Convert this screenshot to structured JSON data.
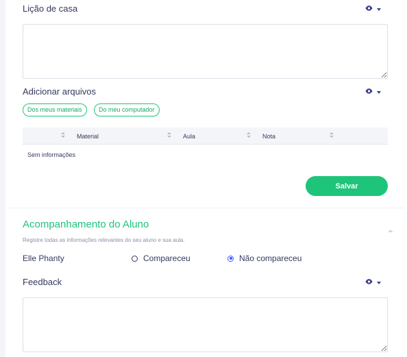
{
  "homework": {
    "label": "Lição de casa"
  },
  "files": {
    "label": "Adicionar arquivos",
    "chips": [
      "Dos meus materiais",
      "Do meu computador"
    ],
    "columns": [
      "Material",
      "Aula",
      "Nota"
    ],
    "empty_text": "Sem informações"
  },
  "save_label": "Salvar",
  "followup": {
    "title": "Acompanhamento do Aluno",
    "subtitle": "Registre todas as informações relevantes do seu aluno e sua aula.",
    "student_name": "Elle Phanty",
    "attendance_options": [
      "Compareceu",
      "Não compareceu"
    ],
    "attendance_selected": "Não compareceu",
    "feedback_label": "Feedback"
  },
  "icons": {
    "visibility": "eye-icon",
    "dropdown": "caret-down-icon",
    "collapse": "chevron-up-icon",
    "sort": "sort-icon"
  },
  "colors": {
    "accent": "#1ec47a",
    "text": "#34395e",
    "radio_selected": "#3d5afe",
    "icon": "#3b3f8f"
  }
}
